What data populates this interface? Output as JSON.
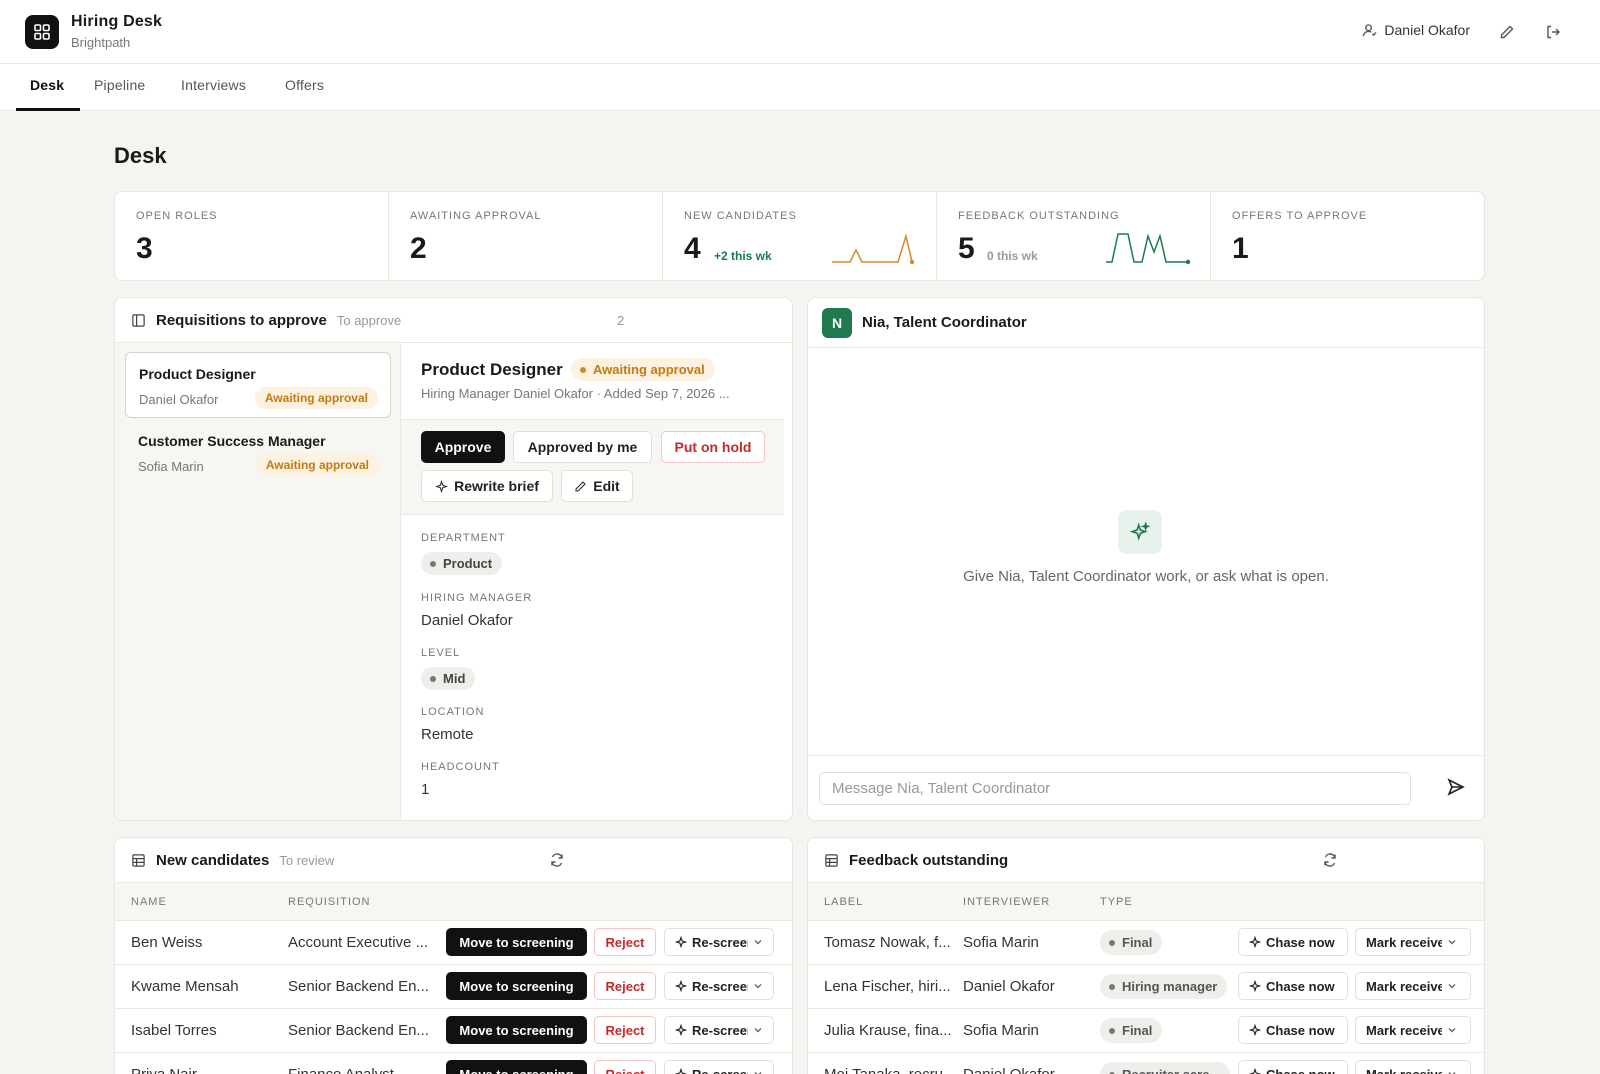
{
  "app": {
    "title": "Hiring Desk",
    "org": "Brightpath"
  },
  "user": {
    "name": "Daniel Okafor"
  },
  "tabs": [
    "Desk",
    "Pipeline",
    "Interviews",
    "Offers"
  ],
  "page": {
    "title": "Desk"
  },
  "stats": [
    {
      "label": "OPEN ROLES",
      "value": "3"
    },
    {
      "label": "AWAITING APPROVAL",
      "value": "2"
    },
    {
      "label": "NEW CANDIDATES",
      "value": "4",
      "delta": "+2 this wk"
    },
    {
      "label": "FEEDBACK OUTSTANDING",
      "value": "5",
      "delta": "0 this wk"
    },
    {
      "label": "OFFERS TO APPROVE",
      "value": "1"
    }
  ],
  "requisitions": {
    "title": "Requisitions to approve",
    "subtitle": "To approve",
    "count": "2",
    "items": [
      {
        "name": "Product Designer",
        "person": "Daniel Okafor",
        "status": "Awaiting approval"
      },
      {
        "name": "Customer Success Manager",
        "person": "Sofia Marin",
        "status": "Awaiting approval"
      }
    ],
    "detail": {
      "title": "Product Designer",
      "status": "Awaiting approval",
      "meta": "Hiring Manager Daniel Okafor · Added Sep 7, 2026 ...",
      "actions": {
        "approve": "Approve",
        "approved_by_me": "Approved by me",
        "hold": "Put on hold",
        "rewrite": "Rewrite brief",
        "edit": "Edit"
      },
      "fields": {
        "department_label": "DEPARTMENT",
        "department": "Product",
        "manager_label": "HIRING MANAGER",
        "manager": "Daniel Okafor",
        "level_label": "LEVEL",
        "level": "Mid",
        "location_label": "LOCATION",
        "location": "Remote",
        "headcount_label": "HEADCOUNT",
        "headcount": "1"
      }
    }
  },
  "chat": {
    "avatar": "N",
    "title": "Nia, Talent Coordinator",
    "empty": "Give Nia, Talent Coordinator work, or ask what is open.",
    "placeholder": "Message Nia, Talent Coordinator"
  },
  "candidates": {
    "title": "New candidates",
    "subtitle": "To review",
    "columns": [
      "NAME",
      "REQUISITION"
    ],
    "move_label": "Move to screening",
    "reject_label": "Reject",
    "rescreen_label": "Re-screen",
    "rows": [
      {
        "name": "Ben Weiss",
        "req": "Account Executive ..."
      },
      {
        "name": "Kwame Mensah",
        "req": "Senior Backend En..."
      },
      {
        "name": "Isabel Torres",
        "req": "Senior Backend En..."
      },
      {
        "name": "Priya Nair",
        "req": "Finance Analyst"
      }
    ]
  },
  "feedback": {
    "title": "Feedback outstanding",
    "columns": [
      "LABEL",
      "INTERVIEWER",
      "TYPE"
    ],
    "chase_label": "Chase now",
    "mark_label": "Mark received",
    "rows": [
      {
        "label": "Tomasz Nowak, f...",
        "interviewer": "Sofia Marin",
        "type": "Final"
      },
      {
        "label": "Lena Fischer, hiri...",
        "interviewer": "Daniel Okafor",
        "type": "Hiring manager"
      },
      {
        "label": "Julia Krause, fina...",
        "interviewer": "Sofia Marin",
        "type": "Final"
      },
      {
        "label": "Mei Tanaka, recru...",
        "interviewer": "Daniel Okafor",
        "type": "Recruiter scre..."
      }
    ]
  },
  "colors": {
    "accent_green": "#1e7a4c",
    "amber": "#c47a12",
    "danger": "#c32b2b"
  }
}
